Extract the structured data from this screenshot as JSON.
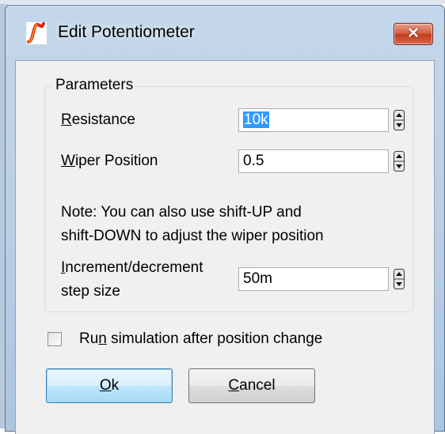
{
  "dialog": {
    "title": "Edit Potentiometer",
    "close_glyph": "✕"
  },
  "icons": {
    "app": "simetrix-app-icon",
    "close": "close-icon",
    "spin": "spin-up-down-icon",
    "checkbox": "checkbox-unchecked-icon"
  },
  "parameters": {
    "group_label": "Parameters",
    "resistance": {
      "label_accel": "R",
      "label_rest": "esistance",
      "value": "10k",
      "selected": true
    },
    "wiper": {
      "label_accel": "W",
      "label_rest": "iper Position",
      "value": "0.5"
    },
    "note_line1": "Note: You can also use shift-UP and",
    "note_line2": "shift-DOWN to adjust the wiper position",
    "increment": {
      "label_accel": "I",
      "label_rest": "ncrement/decrement",
      "label_line2": "step size",
      "value": "50m"
    }
  },
  "run_sim": {
    "label_pre": "Ru",
    "label_accel": "n",
    "label_post": " simulation after position change",
    "checked": false
  },
  "buttons": {
    "ok": {
      "accel": "O",
      "rest": "k"
    },
    "cancel": {
      "accel": "C",
      "rest": "ancel"
    }
  },
  "colors": {
    "selection": "#3399ff",
    "close_button": "#c3391c",
    "default_button_border": "#3c7fb1",
    "title_gradient_top": "#c5d7ea"
  }
}
